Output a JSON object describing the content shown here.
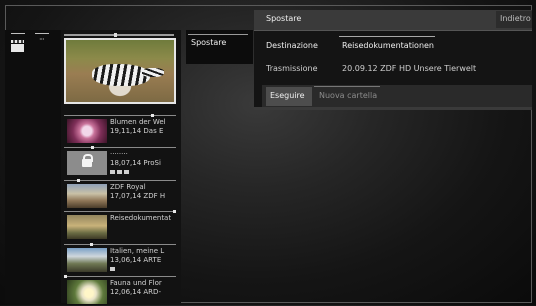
{
  "left_column": {
    "folder_icon": "clapperboard-icon",
    "more_label": "···"
  },
  "thumbnails": {
    "selected": {
      "progress": 0.46
    },
    "rows": [
      {
        "line1": "Blumen der Wel",
        "line2": "19,11,14 Das E",
        "progress": 0.8,
        "art": "flower"
      },
      {
        "line1": "········",
        "line2": "18,07,14 ProSi",
        "progress": 0.25,
        "art": "lock",
        "badges": 3
      },
      {
        "line1": "ZDF Royal",
        "line2": "17,07,14 ZDF H",
        "progress": 0.12,
        "art": "royal"
      },
      {
        "line1": "Reisedokumentat",
        "line2": "",
        "progress": 1.0,
        "art": "reise"
      },
      {
        "line1": "Italien, meine L",
        "line2": "13,06,14 ARTE",
        "progress": 0.24,
        "art": "italien",
        "badges": 1
      },
      {
        "line1": "Fauna und Flor",
        "line2": "12,06,14 ARD-",
        "progress": 0.0,
        "art": "fauna"
      }
    ]
  },
  "middle_panel": {
    "label": "Spostare"
  },
  "dialog": {
    "title": "Spostare",
    "back_label": "Indietro",
    "destination_label": "Destinazione",
    "destination_value": "Reisedokumentationen",
    "transmission_label": "Trasmissione",
    "transmission_value": "20.09.12 ZDF HD Unsere Tierwelt",
    "execute_label": "Eseguire",
    "new_folder_label": "Nuova cartella"
  }
}
